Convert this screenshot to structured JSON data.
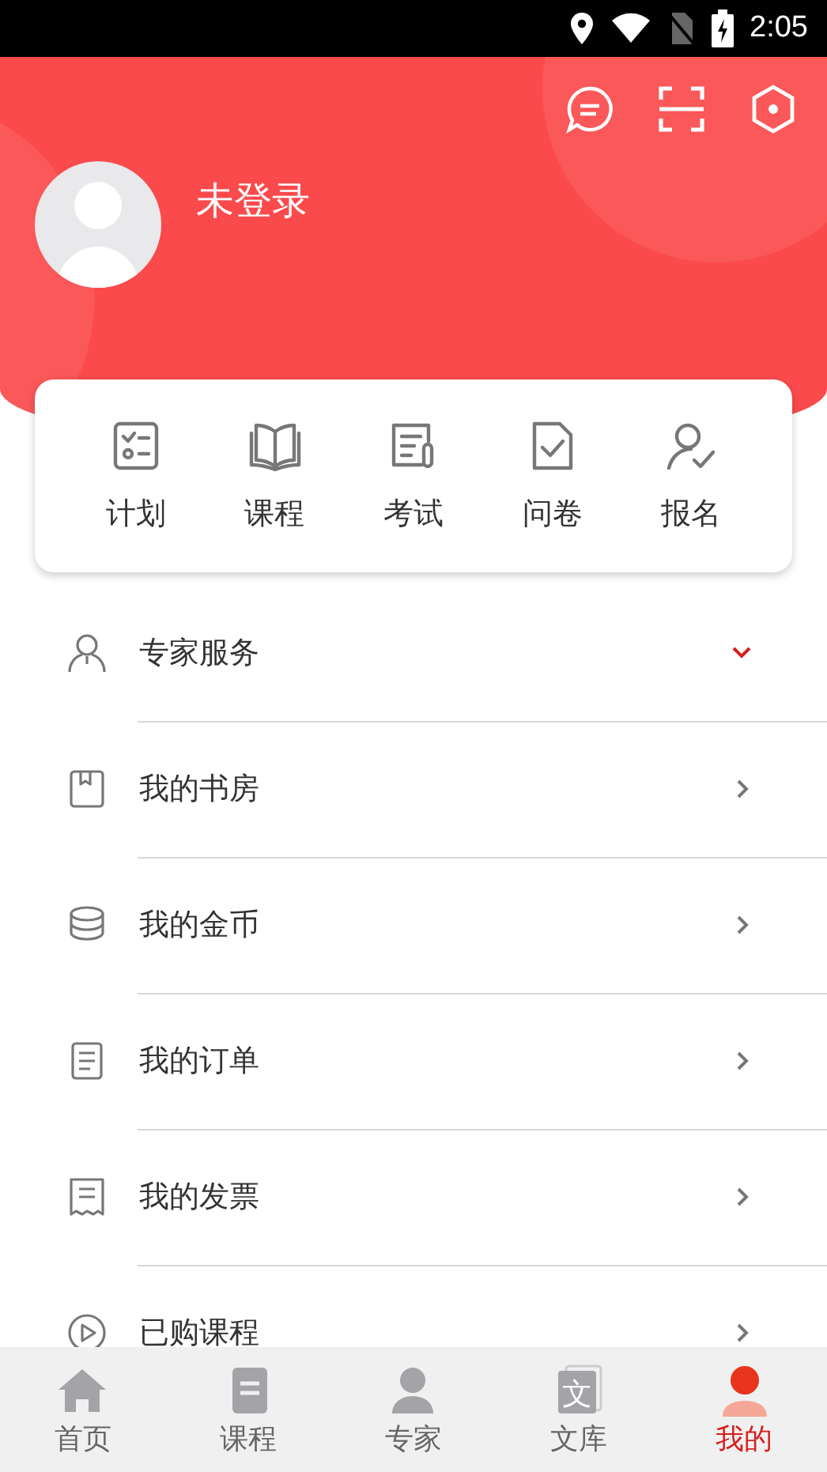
{
  "status_bar": {
    "time": "2:05"
  },
  "header": {
    "user_name": "未登录"
  },
  "shortcuts": [
    {
      "label": "计划"
    },
    {
      "label": "课程"
    },
    {
      "label": "考试"
    },
    {
      "label": "问卷"
    },
    {
      "label": "报名"
    }
  ],
  "menu": [
    {
      "label": "专家服务",
      "kind": "expand"
    },
    {
      "label": "我的书房",
      "kind": "link"
    },
    {
      "label": "我的金币",
      "kind": "link"
    },
    {
      "label": "我的订单",
      "kind": "link"
    },
    {
      "label": "我的发票",
      "kind": "link"
    },
    {
      "label": "已购课程",
      "kind": "link"
    }
  ],
  "tabs": [
    {
      "label": "首页",
      "selected": false
    },
    {
      "label": "课程",
      "selected": false
    },
    {
      "label": "专家",
      "selected": false
    },
    {
      "label": "文库",
      "icon_text": "文",
      "selected": false
    },
    {
      "label": "我的",
      "selected": true
    }
  ]
}
